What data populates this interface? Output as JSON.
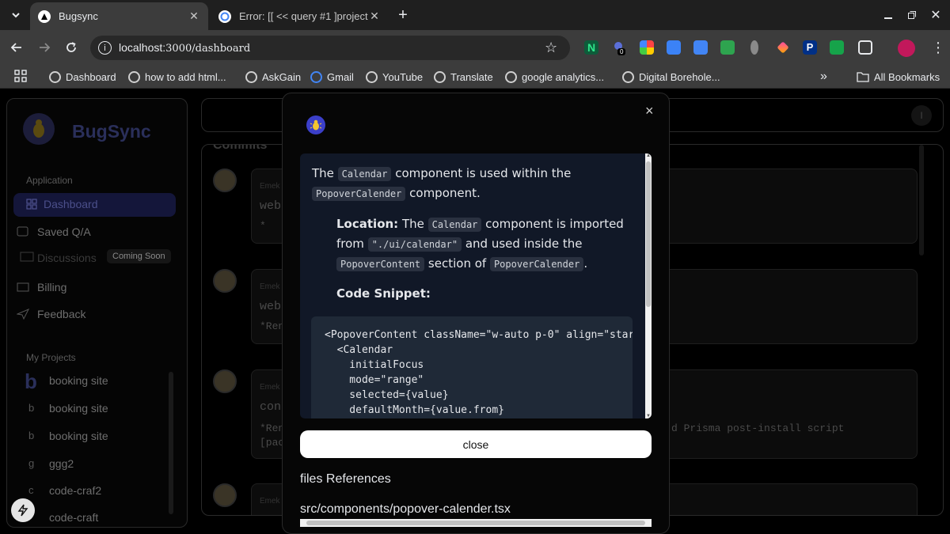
{
  "browser": {
    "tabs": [
      {
        "title": "Bugsync",
        "active": true
      },
      {
        "title": "Error: [[ << query #1 ]project",
        "active": false
      }
    ],
    "url_host": "localhost:",
    "url_rest": "3000/dashboard",
    "bookmarks": [
      "Dashboard",
      "how to add html...",
      "AskGain",
      "Gmail",
      "YouTube",
      "Translate",
      "google analytics...",
      "Digital Borehole..."
    ],
    "all_bookmarks": "All Bookmarks",
    "more_bookmarks": "»",
    "extension_badge": "0",
    "extension_letter_n": "N"
  },
  "sidebar": {
    "brand": "BugSync",
    "section_app": "Application",
    "items": [
      {
        "label": "Dashboard"
      },
      {
        "label": "Saved Q/A"
      },
      {
        "label": "Discussions",
        "badge": "Coming Soon"
      },
      {
        "label": "Billing"
      },
      {
        "label": "Feedback"
      }
    ],
    "section_projects": "My Projects",
    "projects": [
      {
        "initial": "b",
        "name": "booking site"
      },
      {
        "initial": "b",
        "name": "booking site"
      },
      {
        "initial": "b",
        "name": "booking site"
      },
      {
        "initial": "g",
        "name": "ggg2"
      },
      {
        "initial": "c",
        "name": "code-craf2"
      },
      {
        "initial": "c",
        "name": "code-craft"
      }
    ]
  },
  "main": {
    "section_title": "Commits",
    "avatar_initial": "I",
    "commits": [
      {
        "author": "Emek",
        "title": "web",
        "body": "*"
      },
      {
        "author": "Emek",
        "title": "web",
        "body": "*Ren"
      },
      {
        "author": "Emek",
        "title": "con",
        "body": "*Ren",
        "body_right": "d Prisma post-install script",
        "body2": "[pac"
      },
      {
        "author": "Emek",
        "title": "",
        "body": ""
      }
    ]
  },
  "modal": {
    "close_x": "×",
    "p1_before": "The ",
    "p1_code1": "Calendar",
    "p1_mid": " component is used within the ",
    "p1_code2": "PopoverCalender",
    "p1_after": " component.",
    "loc_label": "Location:",
    "loc_t1": " The ",
    "loc_code1": "Calendar",
    "loc_t2": " component is imported from ",
    "loc_code2": "\"./ui/calendar\"",
    "loc_t3": " and used inside the ",
    "loc_code3": "PopoverContent",
    "loc_t4": " section of ",
    "loc_code4": "PopoverCalender",
    "loc_t5": ".",
    "snippet_label": "Code Snippet:",
    "code": "<PopoverContent className=\"w-auto p-0\" align=\"start\">\n  <Calendar\n    initialFocus\n    mode=\"range\"\n    selected={value}\n    defaultMonth={value.from}\n    onSelect={handleSelect}",
    "close_label": "close",
    "files_heading": "files References",
    "file": "src/components/popover-calender.tsx"
  }
}
